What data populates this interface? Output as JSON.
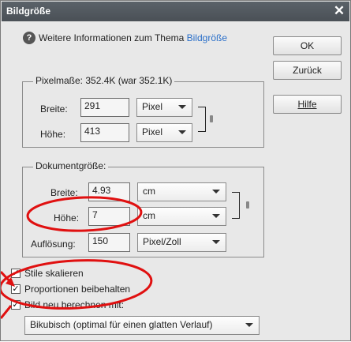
{
  "dialog": {
    "title": "Bildgröße",
    "close_glyph": "✕"
  },
  "info": {
    "text": "Weitere Informationen zum Thema ",
    "link": "Bildgröße",
    "icon": "help-circle-icon"
  },
  "buttons": {
    "ok": "OK",
    "back": "Zurück",
    "help": "Hilfe"
  },
  "pixel_dimensions": {
    "legend": "Pixelmaße: 352.4K (war 352.1K)",
    "width_label": "Breite:",
    "width_value": "291",
    "width_unit": "Pixel",
    "height_label": "Höhe:",
    "height_value": "413",
    "height_unit": "Pixel"
  },
  "document_size": {
    "legend": "Dokumentgröße:",
    "width_label": "Breite:",
    "width_value": "4.93",
    "width_unit": "cm",
    "height_label": "Höhe:",
    "height_value": "7",
    "height_unit": "cm",
    "resolution_label": "Auflösung:",
    "resolution_value": "150",
    "resolution_unit": "Pixel/Zoll"
  },
  "options": {
    "scale_styles": {
      "label": "Stile skalieren",
      "checked": true
    },
    "constrain_proportions": {
      "label": "Proportionen beibehalten",
      "checked": true
    },
    "resample": {
      "label": "Bild neu berechnen mit:",
      "checked": true
    }
  },
  "resample_method": "Bikubisch (optimal für einen glatten Verlauf)",
  "colors": {
    "annotation_red": "#e01010",
    "link_blue": "#2a6fc9",
    "titlebar": "#50575d"
  }
}
